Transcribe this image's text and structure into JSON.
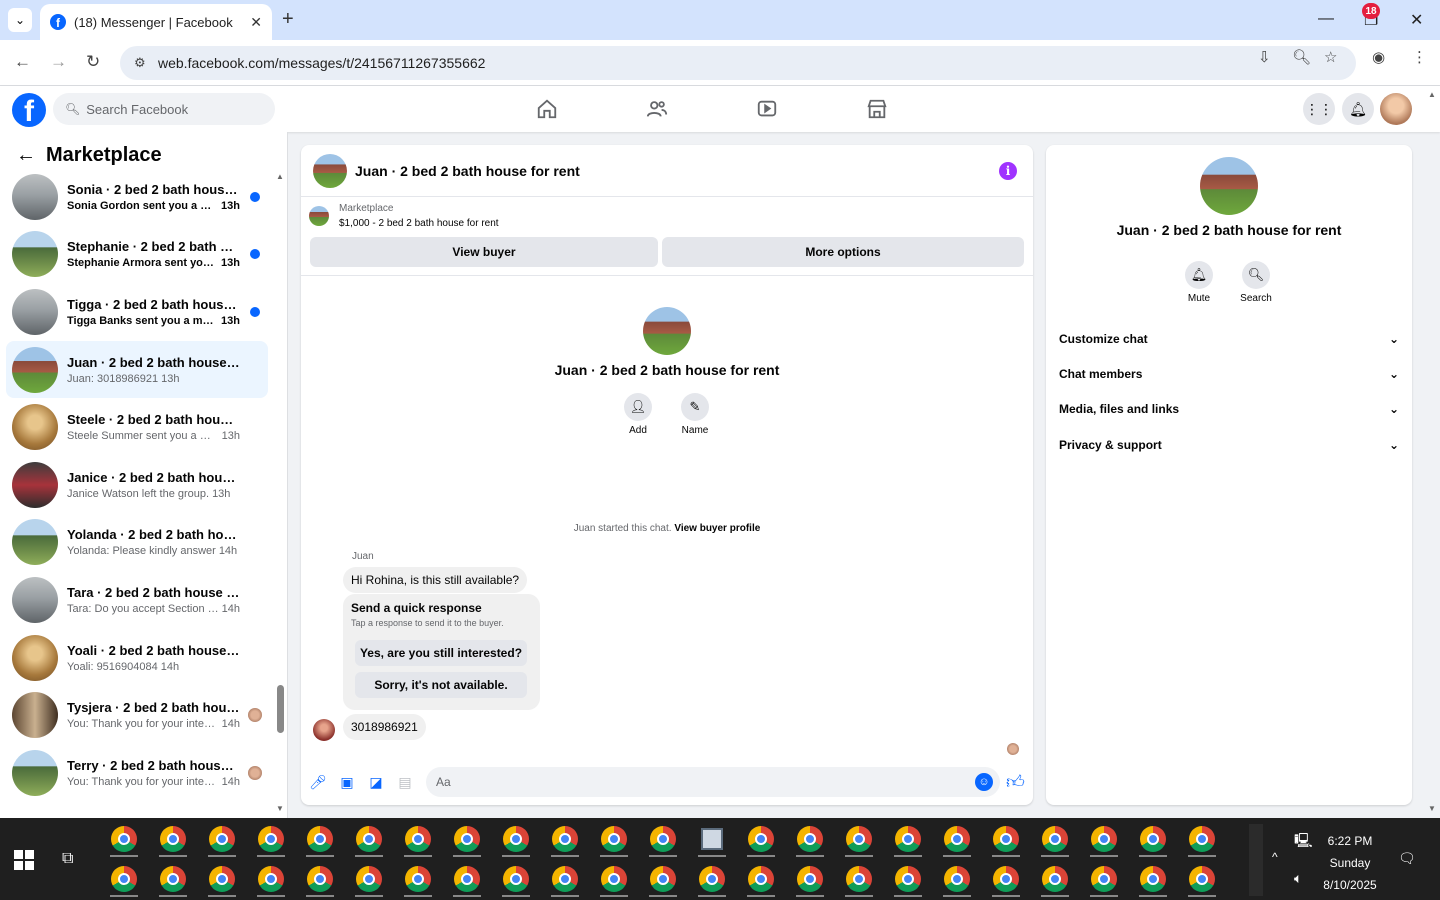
{
  "browser": {
    "tab_title": "(18) Messenger | Facebook",
    "url": "web.facebook.com/messages/t/24156711267355662",
    "new_tab": "+",
    "close_tab": "✕"
  },
  "fb_header": {
    "search_placeholder": "Search Facebook",
    "notification_count": "18"
  },
  "left": {
    "title": "Marketplace",
    "conversations": [
      {
        "name": "Sonia · 2 bed 2 bath house for...",
        "message": "Sonia Gordon sent you a mess...",
        "time": "13h",
        "thumb": "grey",
        "unread": true
      },
      {
        "name": "Stephanie · 2 bed 2 bath hous...",
        "message": "Stephanie Armora sent you a ...",
        "time": "13h",
        "thumb": "green",
        "unread": true
      },
      {
        "name": "Tigga · 2 bed 2 bath house for...",
        "message": "Tigga Banks sent you a messa...",
        "time": "13h",
        "thumb": "grey",
        "unread": true
      },
      {
        "name": "Juan · 2 bed 2 bath house for re...",
        "message": "Juan: 3018986921",
        "time": "13h",
        "thumb": "house",
        "unread": false,
        "active": true
      },
      {
        "name": "Steele · 2 bed 2 bath house for r...",
        "message": "Steele Summer sent you a messa...",
        "time": "13h",
        "thumb": "brown",
        "unread": false
      },
      {
        "name": "Janice · 2 bed 2 bath house for ...",
        "message": "Janice Watson left the group.",
        "time": "13h",
        "thumb": "dark",
        "unread": false
      },
      {
        "name": "Yolanda · 2 bed 2 bath house fo...",
        "message": "Yolanda: Please kindly answer",
        "time": "14h",
        "thumb": "green",
        "unread": false
      },
      {
        "name": "Tara · 2 bed 2 bath house for rent",
        "message": "Tara: Do you accept Section 8 for ...",
        "time": "14h",
        "thumb": "grey",
        "unread": false
      },
      {
        "name": "Yoali · 2 bed 2 bath house for re...",
        "message": "Yoali: 9516904084",
        "time": "14h",
        "thumb": "brown",
        "unread": false
      },
      {
        "name": "Tysjera · 2 bed 2 bath house f...",
        "message": "You: Thank you for your intere...",
        "time": "14h",
        "thumb": "room",
        "unread": false,
        "seen": true
      },
      {
        "name": "Terry · 2 bed 2 bath house for...",
        "message": "You: Thank you for your intere...",
        "time": "14h",
        "thumb": "green",
        "unread": false,
        "seen": true
      }
    ]
  },
  "chat": {
    "title": "Juan · 2 bed 2 bath house for rent",
    "listing_label": "Marketplace",
    "listing_detail": "$1,000 - 2 bed 2 bath house for rent",
    "view_buyer": "View buyer",
    "more_options": "More options",
    "center_name": "Juan · 2 bed 2 bath house for rent",
    "add_label": "Add",
    "name_label": "Name",
    "started_text": "Juan started this chat.",
    "view_buyer_profile": "View buyer profile",
    "sender": "Juan",
    "message1": "Hi Rohina, is this still available?",
    "quick_title": "Send a quick response",
    "quick_sub": "Tap a response to send it to the buyer.",
    "quick_opt1": "Yes, are you still interested?",
    "quick_opt2": "Sorry, it's not available.",
    "message2": "3018986921",
    "composer_placeholder": "Aa"
  },
  "right": {
    "name": "Juan · 2 bed 2 bath house for rent",
    "mute": "Mute",
    "search": "Search",
    "sections": [
      "Customize chat",
      "Chat members",
      "Media, files and links",
      "Privacy & support"
    ]
  },
  "taskbar": {
    "time": "6:22 PM",
    "day": "Sunday",
    "date": "8/10/2025"
  },
  "colors": {
    "fb_blue": "#0866ff",
    "unread_dot": "#0866ff",
    "info_purple": "#a033ff",
    "badge_red": "#e41e3f"
  }
}
